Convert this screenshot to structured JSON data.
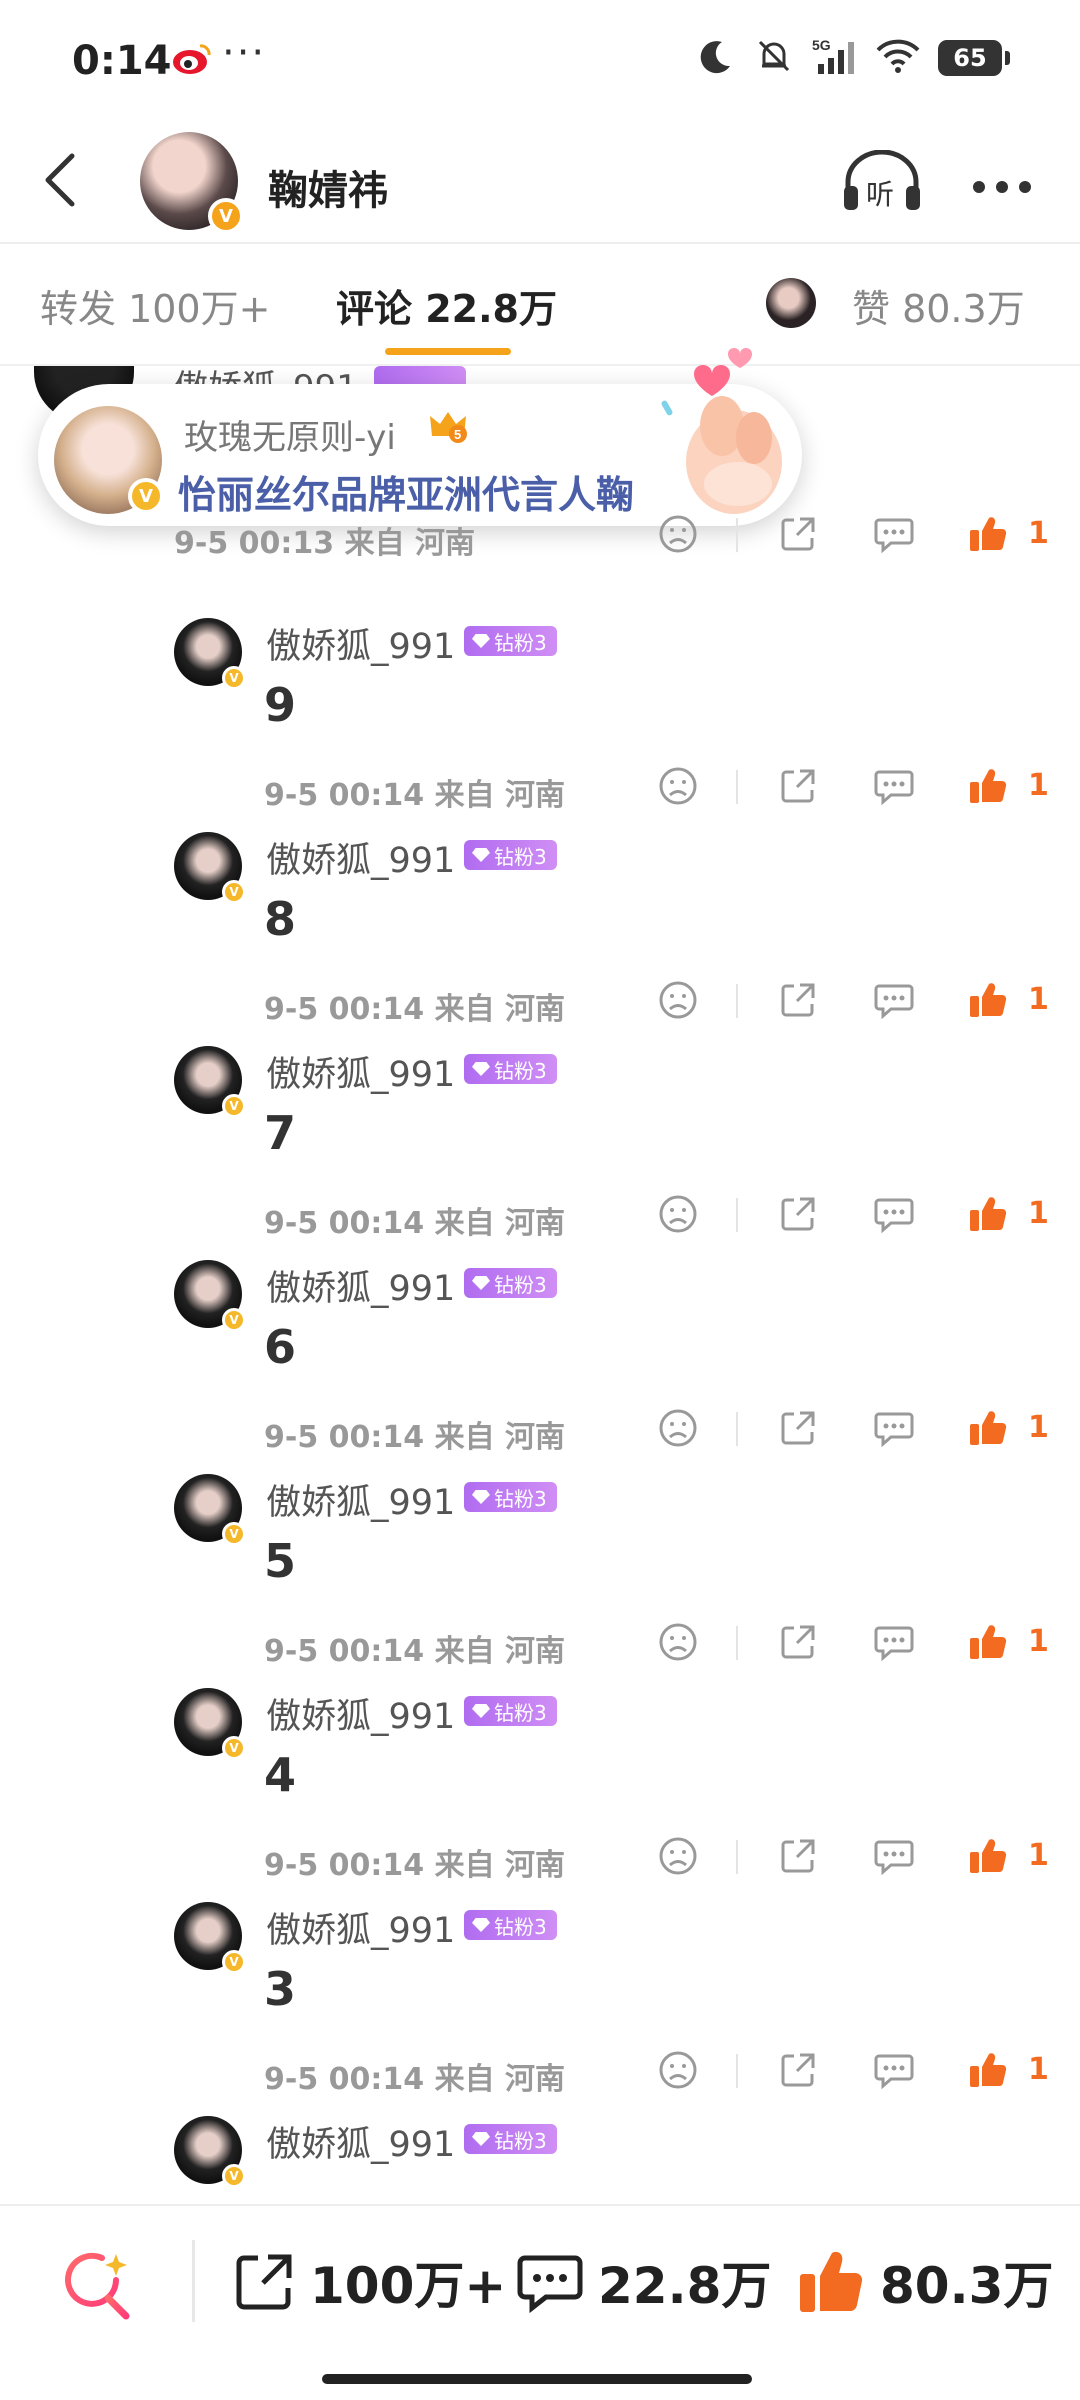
{
  "status_bar": {
    "time": "0:14",
    "dots": "···",
    "network": "5G",
    "battery": "65"
  },
  "header": {
    "title": "鞠婧祎",
    "listen_label": "听",
    "verified_badge": "V"
  },
  "tabs": {
    "repost": "转发 100万+",
    "comments": "评论 22.8万",
    "likes": "赞 80.3万"
  },
  "partial_comment": {
    "username": "傲娇狐_991",
    "meta": "9-5 00:13 来自 河南",
    "like_count": "1"
  },
  "popup": {
    "username": "玫瑰无原则-yi",
    "crown_level": "5",
    "title": "怡丽丝尔品牌亚洲代言人鞠"
  },
  "comments": [
    {
      "username": "傲娇狐_991",
      "badge": "钻粉3",
      "text": "9",
      "meta": "9-5 00:14 来自 河南",
      "like_count": "1"
    },
    {
      "username": "傲娇狐_991",
      "badge": "钻粉3",
      "text": "8",
      "meta": "9-5 00:14 来自 河南",
      "like_count": "1"
    },
    {
      "username": "傲娇狐_991",
      "badge": "钻粉3",
      "text": "7",
      "meta": "9-5 00:14 来自 河南",
      "like_count": "1"
    },
    {
      "username": "傲娇狐_991",
      "badge": "钻粉3",
      "text": "6",
      "meta": "9-5 00:14 来自 河南",
      "like_count": "1"
    },
    {
      "username": "傲娇狐_991",
      "badge": "钻粉3",
      "text": "5",
      "meta": "9-5 00:14 来自 河南",
      "like_count": "1"
    },
    {
      "username": "傲娇狐_991",
      "badge": "钻粉3",
      "text": "4",
      "meta": "9-5 00:14 来自 河南",
      "like_count": "1"
    },
    {
      "username": "傲娇狐_991",
      "badge": "钻粉3",
      "text": "3",
      "meta": "9-5 00:14 来自 河南",
      "like_count": "1"
    },
    {
      "username": "傲娇狐_991",
      "badge": "钻粉3",
      "text": "",
      "meta": "",
      "like_count": ""
    }
  ],
  "bottom_bar": {
    "repost_count": "100万+",
    "comment_count": "22.8万",
    "like_count": "80.3万"
  },
  "colors": {
    "accent_orange": "#f26b21",
    "tab_underline": "#f5a31a",
    "fan_badge": "#b06cf0",
    "popup_title": "#4a5fa8"
  },
  "icons": [
    "weibo-icon",
    "moon-icon",
    "mute-icon",
    "signal-icon",
    "wifi-icon",
    "back-icon",
    "headphones-icon",
    "more-icon",
    "dislike-icon",
    "share-icon",
    "comment-icon",
    "like-icon",
    "search-sparkle-icon",
    "crown-icon",
    "heart-hand-icon"
  ]
}
